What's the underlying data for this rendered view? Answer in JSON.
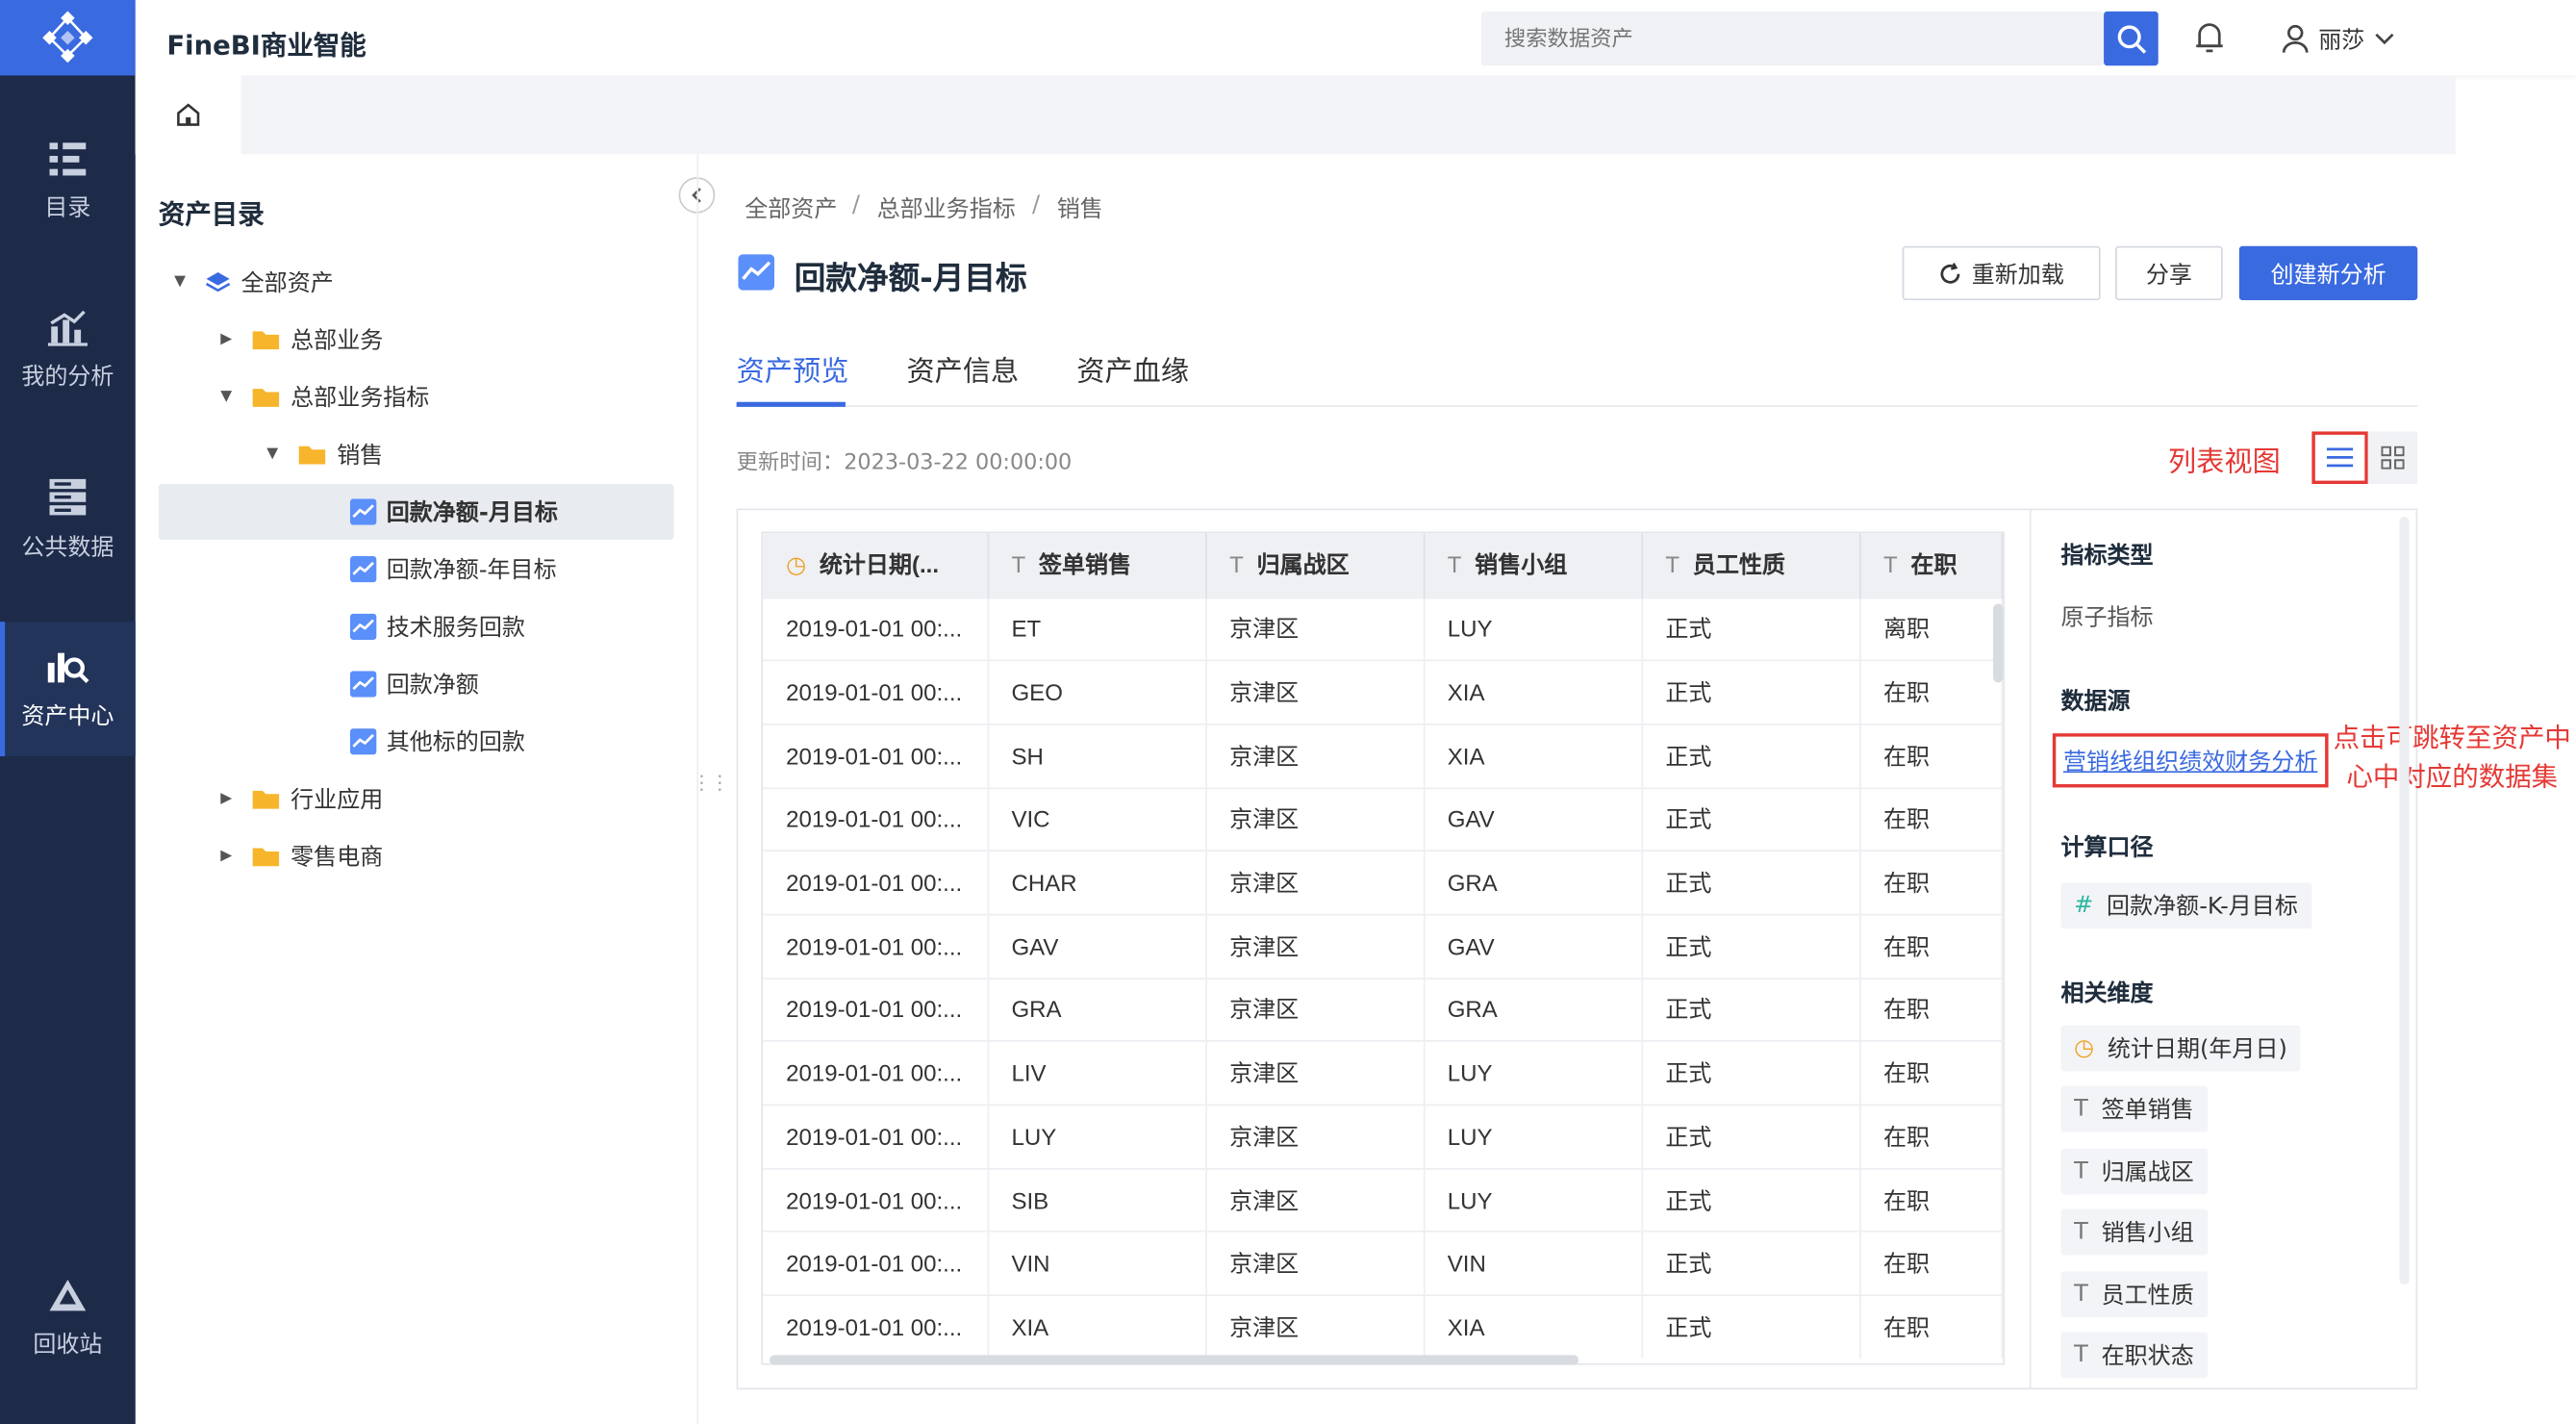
{
  "app": {
    "title": "FineBI商业智能"
  },
  "nav": {
    "items": [
      {
        "label": "目录",
        "icon": "catalog-icon"
      },
      {
        "label": "我的分析",
        "icon": "analysis-icon"
      },
      {
        "label": "公共数据",
        "icon": "public-data-icon"
      },
      {
        "label": "资产中心",
        "icon": "asset-center-icon",
        "active": true
      },
      {
        "label": "回收站",
        "icon": "recycle-icon"
      }
    ]
  },
  "header": {
    "search_placeholder": "搜索数据资产",
    "user_name": "丽莎"
  },
  "tree": {
    "title": "资产目录",
    "items": [
      {
        "label": "全部资产"
      },
      {
        "label": "总部业务"
      },
      {
        "label": "总部业务指标"
      },
      {
        "label": "销售"
      },
      {
        "label": "回款净额-月目标"
      },
      {
        "label": "回款净额-年目标"
      },
      {
        "label": "技术服务回款"
      },
      {
        "label": "回款净额"
      },
      {
        "label": "其他标的回款"
      },
      {
        "label": "行业应用"
      },
      {
        "label": "零售电商"
      }
    ]
  },
  "breadcrumb": [
    "全部资产",
    "总部业务指标",
    "销售"
  ],
  "page": {
    "title": "回款净额-月目标",
    "reload_label": "重新加载",
    "share_label": "分享",
    "create_label": "创建新分析",
    "tabs": [
      "资产预览",
      "资产信息",
      "资产血缘"
    ],
    "update_time": "更新时间：2023-03-22 00:00:00",
    "list_view_label": "列表视图"
  },
  "table": {
    "headers": [
      "统计日期(...",
      "签单销售",
      "归属战区",
      "销售小组",
      "员工性质",
      "在职"
    ],
    "rows": [
      [
        "2019-01-01 00:...",
        "ET",
        "京津区",
        "LUY",
        "正式",
        "离职"
      ],
      [
        "2019-01-01 00:...",
        "GEO",
        "京津区",
        "XIA",
        "正式",
        "在职"
      ],
      [
        "2019-01-01 00:...",
        "SH",
        "京津区",
        "XIA",
        "正式",
        "在职"
      ],
      [
        "2019-01-01 00:...",
        "VIC",
        "京津区",
        "GAV",
        "正式",
        "在职"
      ],
      [
        "2019-01-01 00:...",
        "CHAR",
        "京津区",
        "GRA",
        "正式",
        "在职"
      ],
      [
        "2019-01-01 00:...",
        "GAV",
        "京津区",
        "GAV",
        "正式",
        "在职"
      ],
      [
        "2019-01-01 00:...",
        "GRA",
        "京津区",
        "GRA",
        "正式",
        "在职"
      ],
      [
        "2019-01-01 00:...",
        "LIV",
        "京津区",
        "LUY",
        "正式",
        "在职"
      ],
      [
        "2019-01-01 00:...",
        "LUY",
        "京津区",
        "LUY",
        "正式",
        "在职"
      ],
      [
        "2019-01-01 00:...",
        "SIB",
        "京津区",
        "LUY",
        "正式",
        "在职"
      ],
      [
        "2019-01-01 00:...",
        "VIN",
        "京津区",
        "VIN",
        "正式",
        "在职"
      ],
      [
        "2019-01-01 00:...",
        "XIA",
        "京津区",
        "XIA",
        "正式",
        "在职"
      ]
    ]
  },
  "info": {
    "metric_type_label": "指标类型",
    "metric_type_value": "原子指标",
    "datasource_label": "数据源",
    "datasource_link": "营销线组织绩效财务分析",
    "annotation": "点击可跳转至资产中心中对应的数据集",
    "calc_label": "计算口径",
    "calc_value": "回款净额-K-月目标",
    "dims_label": "相关维度",
    "dims": [
      "统计日期(年月日)",
      "签单销售",
      "归属战区",
      "销售小组",
      "员工性质",
      "在职状态"
    ]
  },
  "colors": {
    "accent": "#3a6ae0",
    "nav_bg": "#1d2a48",
    "annotation": "#e53935"
  }
}
